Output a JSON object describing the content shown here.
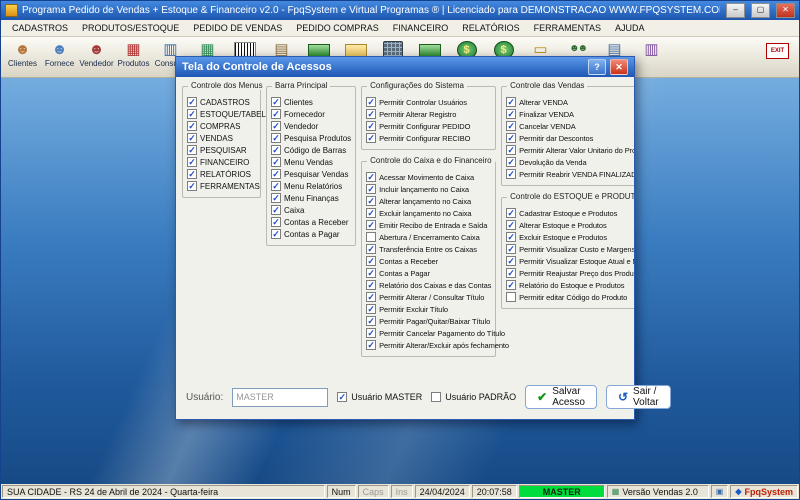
{
  "window": {
    "title": "Programa Pedido de Vendas + Estoque & Financeiro v2.0 - FpqSystem e Virtual Programas ® | Licenciado para  DEMONSTRACAO WWW.FPQSYSTEM.COM.BR"
  },
  "icons": {
    "minimize": "–",
    "maximize": "▢",
    "close": "✕",
    "help": "?",
    "check_small": "✓",
    "save_check": "✔",
    "back_arrow": "↺"
  },
  "menubar": [
    "CADASTROS",
    "PRODUTOS/ESTOQUE",
    "PEDIDO DE VENDAS",
    "PEDIDO COMPRAS",
    "FINANCEIRO",
    "RELATÓRIOS",
    "FERRAMENTAS",
    "AJUDA"
  ],
  "toolbar": [
    {
      "name": "clientes",
      "label": "Clientes",
      "glyph": "☻",
      "color": "#b5773a"
    },
    {
      "name": "fornecedor",
      "label": "Fornece",
      "glyph": "☻",
      "color": "#4f81bd"
    },
    {
      "name": "vendedor",
      "label": "Vendedor",
      "glyph": "☻",
      "color": "#a33a3a"
    },
    {
      "name": "produtos",
      "label": "Produtos",
      "glyph": "▦",
      "color": "#b03030"
    },
    {
      "name": "consulta-produtos",
      "label": "Consulta",
      "glyph": "▥",
      "color": "#3868a8"
    },
    {
      "name": "menu-vendas",
      "label": "",
      "glyph": "▦",
      "color": "#2e8b57"
    },
    {
      "name": "codigo-barras",
      "label": "",
      "shape": "shape-barcode"
    },
    {
      "name": "caixa",
      "label": "",
      "glyph": "▤",
      "color": "#8a6d3b"
    },
    {
      "name": "dinheiro",
      "label": "",
      "shape": "shape-money"
    },
    {
      "name": "financeiro",
      "label": "",
      "shape": "shape-folder"
    },
    {
      "name": "calculadora",
      "label": "",
      "shape": "shape-calc"
    },
    {
      "name": "movimento-caixa",
      "label": "",
      "shape": "shape-money"
    },
    {
      "name": "contas-receber",
      "label": "",
      "shape": "shape-coin",
      "glyph": "$"
    },
    {
      "name": "contas-pagar",
      "label": "",
      "shape": "shape-coin",
      "glyph": "$"
    },
    {
      "name": "recibos",
      "label": "",
      "glyph": "▭",
      "color": "#b8860b"
    },
    {
      "name": "usuarios",
      "label": "",
      "shape": "shape-people",
      "glyph": "☻☻",
      "color": "#2f6b2f"
    },
    {
      "name": "documentos",
      "label": "",
      "glyph": "▤",
      "color": "#4a6fa5"
    },
    {
      "name": "relatorios",
      "label": "",
      "glyph": "▥",
      "color": "#7a4a9e"
    },
    {
      "name": "sair",
      "label": "",
      "shape": "shape-exit",
      "glyph": "EXIT",
      "push_right": true
    }
  ],
  "dialog": {
    "title": "Tela do Controle de Acessos",
    "groups": [
      {
        "title": "Controle dos Menus",
        "items": [
          {
            "label": "CADASTROS",
            "checked": true
          },
          {
            "label": "ESTOQUE/TABELAS",
            "checked": true
          },
          {
            "label": "COMPRAS",
            "checked": true
          },
          {
            "label": "VENDAS",
            "checked": true
          },
          {
            "label": "PESQUISAR",
            "checked": true
          },
          {
            "label": "FINANCEIRO",
            "checked": true
          },
          {
            "label": "RELATÓRIOS",
            "checked": true
          },
          {
            "label": "FERRAMENTAS",
            "checked": true
          }
        ]
      },
      {
        "title": "Barra Principal",
        "items": [
          {
            "label": "Clientes",
            "checked": true
          },
          {
            "label": "Fornecedor",
            "checked": true
          },
          {
            "label": "Vendedor",
            "checked": true
          },
          {
            "label": "Pesquisa Produtos",
            "checked": true
          },
          {
            "label": "Código de Barras",
            "checked": true
          },
          {
            "label": "Menu Vendas",
            "checked": true
          },
          {
            "label": "Pesquisar Vendas",
            "checked": true
          },
          {
            "label": "Menu Relatórios",
            "checked": true
          },
          {
            "label": "Menu Finanças",
            "checked": true
          },
          {
            "label": "Caixa",
            "checked": true
          },
          {
            "label": "Contas a Receber",
            "checked": true
          },
          {
            "label": "Contas a Pagar",
            "checked": true
          }
        ]
      },
      {
        "title": "Configurações do Sistema",
        "items": [
          {
            "label": "Permitir Controlar Usuários",
            "checked": true
          },
          {
            "label": "Permitir Alterar Registro",
            "checked": true
          },
          {
            "label": "Permitir Configurar PEDIDO",
            "checked": true
          },
          {
            "label": "Permitir Configurar RECIBO",
            "checked": true
          }
        ]
      },
      {
        "title": "Controle do Caixa e do Financeiro",
        "items": [
          {
            "label": "Acessar Movimento de Caixa",
            "checked": true
          },
          {
            "label": "Incluir lançamento no Caixa",
            "checked": true
          },
          {
            "label": "Alterar lançamento no Caixa",
            "checked": true
          },
          {
            "label": "Excluir lançamento no Caixa",
            "checked": true
          },
          {
            "label": "Emitir Recibo de Entrada e Saída",
            "checked": true
          },
          {
            "label": "Abertura / Encerramento Caixa",
            "checked": false
          },
          {
            "label": "Transferência Entre os Caixas",
            "checked": true
          },
          {
            "label": "Contas a Receber",
            "checked": true
          },
          {
            "label": "Contas a Pagar",
            "checked": true
          },
          {
            "label": "Relatório dos Caixas e das Contas",
            "checked": true
          },
          {
            "label": "Permitir Alterar / Consultar Título",
            "checked": true
          },
          {
            "label": "Permitir Excluir Título",
            "checked": true
          },
          {
            "label": "Permitir Pagar/Quitar/Baixar Título",
            "checked": true
          },
          {
            "label": "Permitir Cancelar Pagamento do Título",
            "checked": true
          },
          {
            "label": "Permitir Alterar/Excluir após fechamento",
            "checked": true
          }
        ]
      },
      {
        "title": "Controle das Vendas",
        "items": [
          {
            "label": "Alterar VENDA",
            "checked": true
          },
          {
            "label": "Finalizar VENDA",
            "checked": true
          },
          {
            "label": "Cancelar VENDA",
            "checked": true
          },
          {
            "label": "Permitir dar Descontos",
            "checked": true
          },
          {
            "label": "Permitir Alterar Valor Unitario do Produto",
            "checked": true
          },
          {
            "label": "Devolução da Venda",
            "checked": true
          },
          {
            "label": "Permitir Reabrir VENDA FINALIZADA",
            "checked": true
          }
        ]
      },
      {
        "title": "Controle do ESTOQUE e PRODUTOS",
        "items": [
          {
            "label": "Cadastrar Estoque e Produtos",
            "checked": true
          },
          {
            "label": "Alterar Estoque e Produtos",
            "checked": true
          },
          {
            "label": "Excluir Estoque e Produtos",
            "checked": true
          },
          {
            "label": "Permitir Visualizar Custo e Margens",
            "checked": true
          },
          {
            "label": "Permitir Visualizar Estoque Atual e Minimo",
            "checked": true
          },
          {
            "label": "Permitir Reajustar Preço dos Produtos",
            "checked": true
          },
          {
            "label": "Relatório do Estoque e Produtos",
            "checked": true
          },
          {
            "label": "Permitir editar Código do Produto",
            "checked": false
          }
        ]
      }
    ],
    "footer": {
      "user_label": "Usuário:",
      "user_value": "MASTER",
      "master_checkbox": "Usuário MASTER",
      "padrao_checkbox": "Usuário PADRÃO",
      "save_button": "Salvar Acesso",
      "exit_button": "Sair / Voltar"
    }
  },
  "statusbar": {
    "location": "SUA CIDADE - RS 24 de Abril de 2024 - Quarta-feira",
    "num": "Num",
    "caps": "Caps",
    "ins": "Ins",
    "date": "24/04/2024",
    "time": "20:07:58",
    "user": "MASTER",
    "version": "Versão Vendas 2.0",
    "brand": "FpqSystem"
  }
}
